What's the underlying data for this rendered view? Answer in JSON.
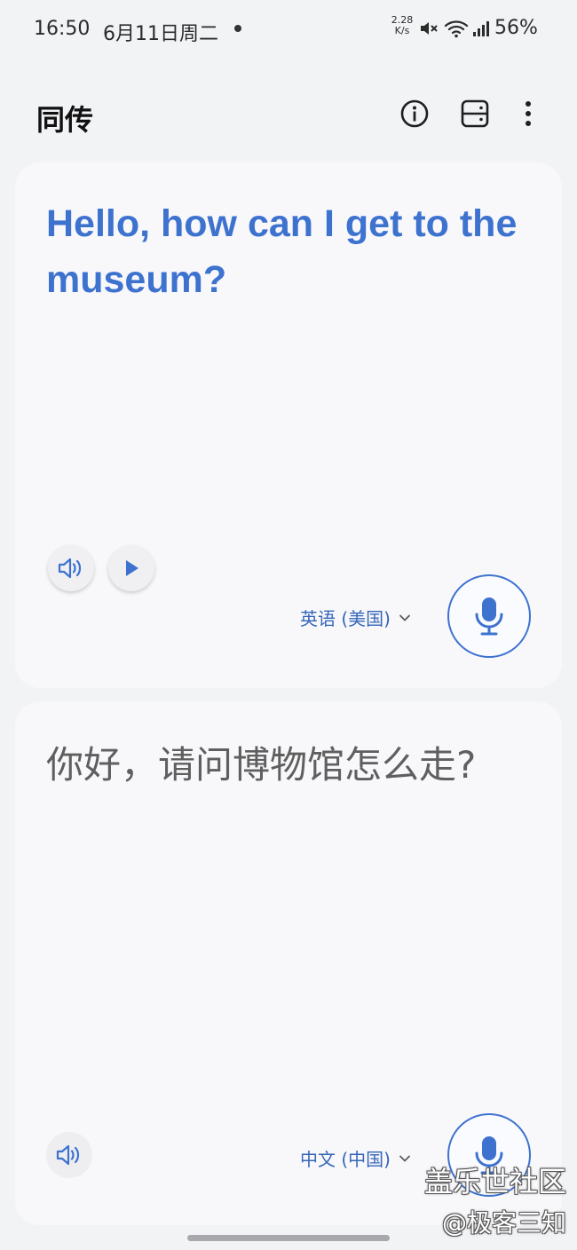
{
  "status_bar": {
    "time": "16:50",
    "date": "6月11日周二",
    "net_speed_value": "2.28",
    "net_speed_unit": "K/s",
    "battery": "56%",
    "icons": [
      "mute-icon",
      "wifi-icon",
      "signal-icon"
    ]
  },
  "app_bar": {
    "title": "同传",
    "actions": [
      "info-icon",
      "layout-icon",
      "more-vert-icon"
    ]
  },
  "source_panel": {
    "text": "Hello, how can I get to the museum?",
    "language": "英语 (美国)",
    "text_color": "#3d72cf",
    "buttons": [
      "speaker-icon",
      "play-icon",
      "mic-icon"
    ]
  },
  "target_panel": {
    "text": "你好，请问博物馆怎么走?",
    "language": "中文 (中国)",
    "text_color": "#5f5f5f",
    "buttons": [
      "speaker-icon",
      "mic-icon"
    ]
  },
  "watermark": {
    "line1": "盖乐世社区",
    "line2": "@极客三知"
  },
  "colors": {
    "accent": "#3d72cf",
    "background": "#f2f3f5",
    "panel": "#f8f8fb"
  }
}
